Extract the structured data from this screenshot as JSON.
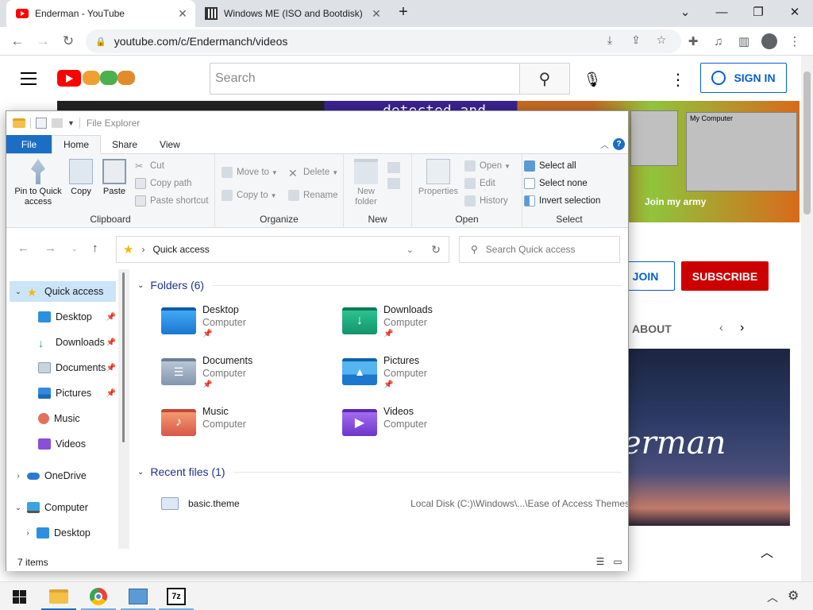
{
  "browser": {
    "tabs": [
      {
        "title": "Enderman - YouTube",
        "close": "✕"
      },
      {
        "title": "Windows ME (ISO and Bootdisk)",
        "close": "✕"
      }
    ],
    "new_tab": "+",
    "window_controls": {
      "tabsearch": "⌄",
      "minimize": "—",
      "restore": "❐",
      "close": "✕"
    },
    "url": "youtube.com/c/Endermanch/videos"
  },
  "youtube": {
    "search_placeholder": "Search",
    "sign_in": "SIGN IN",
    "banner_text": "detected and",
    "banner_join": "Join my army",
    "banner_mycomputer": "My Computer",
    "join": "JOIN",
    "subscribe": "SUBSCRIBE",
    "about": "ABOUT",
    "video_text": "erman"
  },
  "explorer": {
    "title": "File Explorer",
    "ribbon_tabs": [
      "File",
      "Home",
      "Share",
      "View"
    ],
    "help": "?",
    "clipboard": {
      "label": "Clipboard",
      "pin": "Pin to Quick access",
      "copy": "Copy",
      "paste": "Paste",
      "cut": "Cut",
      "copy_path": "Copy path",
      "paste_shortcut": "Paste shortcut"
    },
    "organize": {
      "label": "Organize",
      "move_to": "Move to",
      "copy_to": "Copy to",
      "delete": "Delete",
      "rename": "Rename"
    },
    "new": {
      "label": "New",
      "new_folder": "New folder"
    },
    "open": {
      "label": "Open",
      "properties": "Properties",
      "open": "Open",
      "edit": "Edit",
      "history": "History"
    },
    "select": {
      "label": "Select",
      "select_all": "Select all",
      "select_none": "Select none",
      "invert": "Invert selection"
    },
    "address": {
      "crumb": "Quick access",
      "search_placeholder": "Search Quick access"
    },
    "nav": [
      {
        "label": "Quick access",
        "expander": "⌄"
      },
      {
        "label": "Desktop"
      },
      {
        "label": "Downloads"
      },
      {
        "label": "Documents"
      },
      {
        "label": "Pictures"
      },
      {
        "label": "Music"
      },
      {
        "label": "Videos"
      },
      {
        "label": "OneDrive",
        "expander": "›"
      },
      {
        "label": "Computer",
        "expander": "⌄"
      },
      {
        "label": "Desktop",
        "expander": "›"
      }
    ],
    "folders_header": "Folders (6)",
    "folders": [
      {
        "name": "Desktop",
        "sub": "Computer"
      },
      {
        "name": "Downloads",
        "sub": "Computer"
      },
      {
        "name": "Documents",
        "sub": "Computer"
      },
      {
        "name": "Pictures",
        "sub": "Computer"
      },
      {
        "name": "Music",
        "sub": "Computer"
      },
      {
        "name": "Videos",
        "sub": "Computer"
      }
    ],
    "recent_header": "Recent files (1)",
    "recent": [
      {
        "name": "basic.theme",
        "path": "Local Disk (C:)\\Windows\\...\\Ease of Access Themes"
      }
    ],
    "status": "7 items"
  },
  "colors": {
    "accent": "#1a6fc4",
    "youtube_red": "#ff0000",
    "subscribe_red": "#cc0000",
    "link_blue": "#065fd4"
  }
}
